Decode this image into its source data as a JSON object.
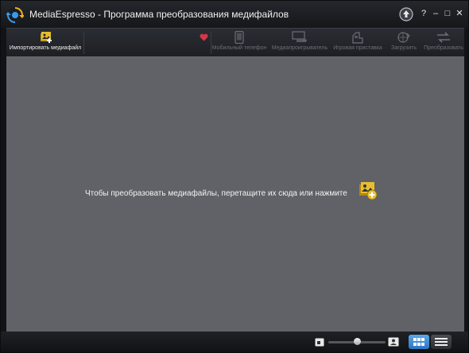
{
  "window": {
    "title": "MediaEspresso - Программа преобразования медифайлов"
  },
  "titlebar_buttons": {
    "help": "?",
    "minimize": "–",
    "maximize": "□",
    "close": "✕"
  },
  "toolbar": {
    "import_label": "Импортировать медиафайл",
    "items": [
      {
        "label": "Мобильный телефон",
        "icon": "mobile-phone-icon"
      },
      {
        "label": "Медиапроигрыватель",
        "icon": "media-player-icon"
      },
      {
        "label": "Игровая приставка",
        "icon": "game-console-icon"
      },
      {
        "label": "Загрузить",
        "icon": "upload-globe-icon"
      },
      {
        "label": "Преобразовать",
        "icon": "convert-arrows-icon"
      }
    ]
  },
  "main": {
    "drop_text": "Чтобы преобразовать медиафайлы, перетащите их сюда или нажмите"
  },
  "colors": {
    "accent_blue": "#3a8ee0",
    "icon_gold": "#d8b12a",
    "heart_red": "#d9354a",
    "panel_gray": "#616168"
  }
}
